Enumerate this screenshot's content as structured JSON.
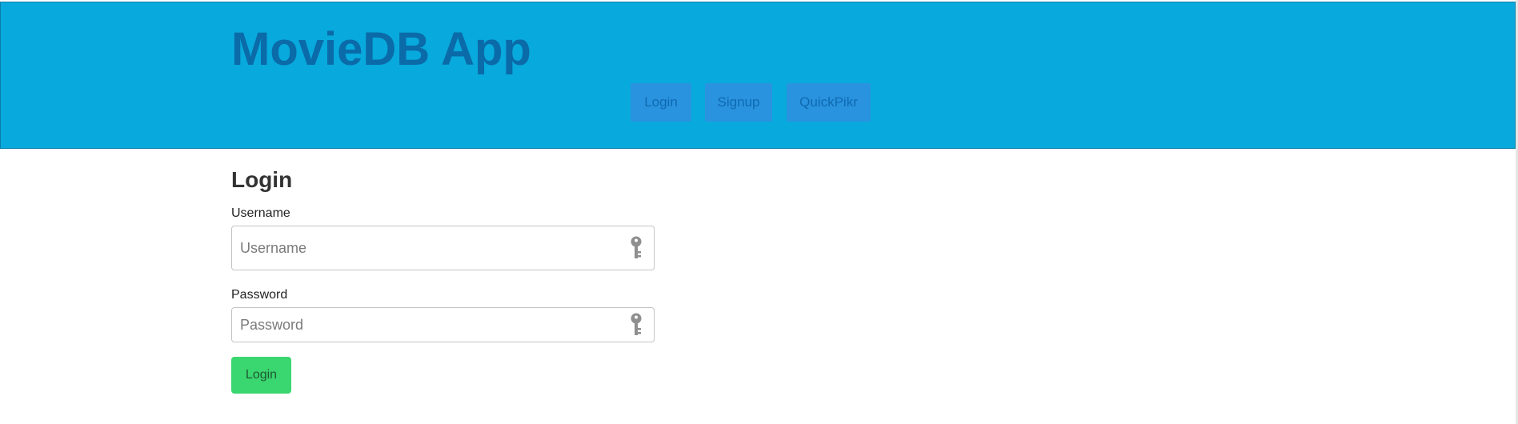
{
  "header": {
    "app_title": "MovieDB App",
    "nav": {
      "login_label": "Login",
      "signup_label": "Signup",
      "quickpikr_label": "QuickPikr"
    }
  },
  "login_form": {
    "title": "Login",
    "username": {
      "label": "Username",
      "placeholder": "Username",
      "value": "",
      "icon": "key-icon"
    },
    "password": {
      "label": "Password",
      "placeholder": "Password",
      "value": "",
      "icon": "key-icon"
    },
    "submit_label": "Login"
  },
  "colors": {
    "header_bg": "#08a9dc",
    "title_color": "#0b6aa8",
    "nav_button_bg": "#2a93e0",
    "submit_button_bg": "#3ad670"
  }
}
